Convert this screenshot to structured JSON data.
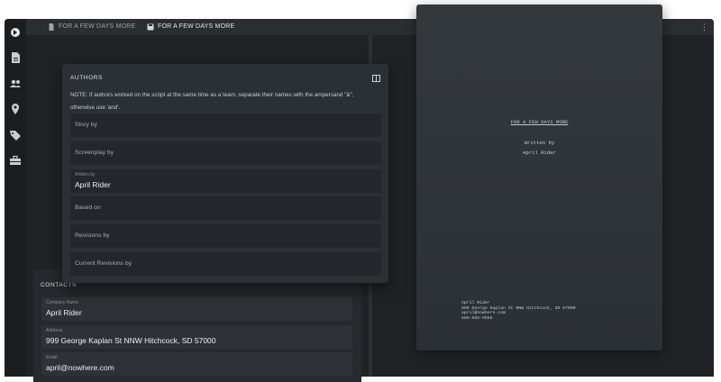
{
  "tabs": [
    {
      "label": "FOR A FEW DAYS MORE",
      "icon": "document-icon"
    },
    {
      "label": "FOR A FEW DAYS MORE",
      "icon": "save-icon"
    }
  ],
  "rail_icons": [
    "app-logo-icon",
    "document-icon",
    "people-icon",
    "location-pin-icon",
    "tag-icon",
    "toolbox-icon"
  ],
  "authors": {
    "title": "AUTHORS",
    "note": "NOTE: If authors worked on the script at the same time as a team, separate their names with the ampersand \"&\", otherwise use 'and'.",
    "fields": [
      {
        "label": "Story by",
        "value": ""
      },
      {
        "label": "Screenplay by",
        "value": ""
      },
      {
        "label": "Written by",
        "value": "April Rider"
      },
      {
        "label": "Based on",
        "value": ""
      },
      {
        "label": "Revisions by",
        "value": ""
      },
      {
        "label": "Current Revisions by",
        "value": ""
      }
    ]
  },
  "contacts": {
    "title": "CONTACTS",
    "fields": [
      {
        "label": "Company Name",
        "value": "April Rider"
      },
      {
        "label": "Address",
        "value": "999 George Kaplan St NNW Hitchcock, SD 57000"
      },
      {
        "label": "Email",
        "value": "april@nowhere.com"
      }
    ]
  },
  "preview": {
    "title": "FOR A FEW DAYS MORE",
    "written_by": "Written by",
    "author": "April Rider",
    "contact_lines": [
      "April Rider",
      "999 George Kaplan St NNW Hitchcock, SD 57000",
      "april@nowhere.com",
      "555-555-5555"
    ]
  },
  "colors": {
    "accent": "#3d86d6",
    "panel": "#2b3035",
    "background": "#1f2225"
  }
}
